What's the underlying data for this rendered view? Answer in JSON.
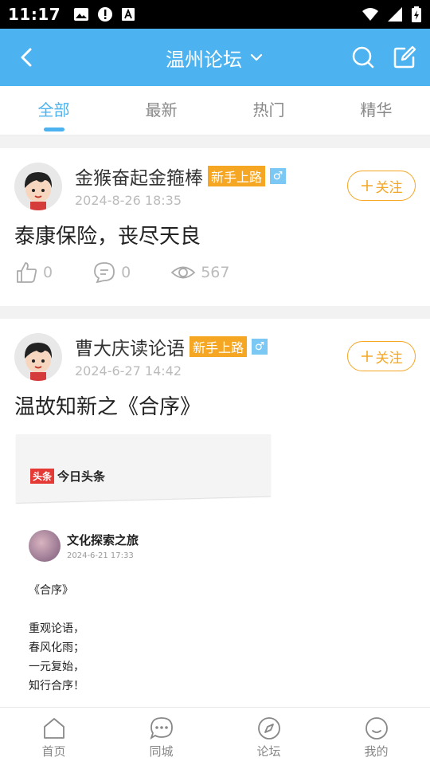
{
  "status": {
    "time": "11:17",
    "left_icons": [
      "image-icon",
      "alert-icon",
      "text-a-icon"
    ],
    "right_icons": [
      "wifi-icon",
      "signal-icon",
      "battery-charging-icon"
    ]
  },
  "header": {
    "title": "温州论坛",
    "background": "#4db3f0"
  },
  "tabs": [
    {
      "label": "全部",
      "active": true
    },
    {
      "label": "最新",
      "active": false
    },
    {
      "label": "热门",
      "active": false
    },
    {
      "label": "精华",
      "active": false
    }
  ],
  "posts": [
    {
      "author": "金猴奋起金箍棒",
      "badge": "新手上路",
      "gender_symbol": "♂",
      "date": "2024-8-26 18:35",
      "follow_label": "关注",
      "title": "泰康保险，丧尽天良",
      "likes": "0",
      "comments": "0",
      "views": "567"
    },
    {
      "author": "曹大庆读论语",
      "badge": "新手上路",
      "gender_symbol": "♂",
      "date": "2024-6-27 14:42",
      "follow_label": "关注",
      "title": "温故知新之《合序》",
      "embed": {
        "brand_mark": "头条",
        "brand_name": "今日头条",
        "author": "文化探索之旅",
        "date": "2024-6-21 17:33",
        "lines": [
          "《合序》",
          "",
          "重观论语，",
          "春风化雨；",
          "一元复始，",
          "知行合序！"
        ]
      }
    }
  ],
  "bottom_nav": [
    {
      "label": "首页",
      "icon": "home-icon"
    },
    {
      "label": "同城",
      "icon": "chat-icon"
    },
    {
      "label": "论坛",
      "icon": "compass-icon"
    },
    {
      "label": "我的",
      "icon": "smile-icon"
    }
  ],
  "colors": {
    "accent": "#4db3f0",
    "orange": "#f5a623"
  }
}
